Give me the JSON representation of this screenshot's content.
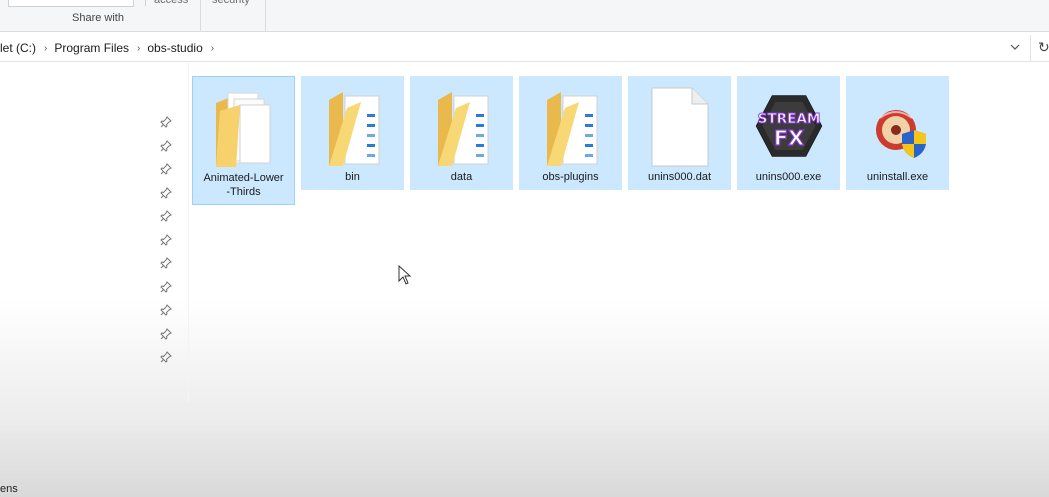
{
  "ribbon": {
    "groups": {
      "share": "Share with",
      "access": "access",
      "security": "security"
    }
  },
  "address": {
    "crumbs": [
      "let (C:)",
      "Program Files",
      "obs-studio"
    ]
  },
  "nav": {
    "pin_count": 11,
    "cut_label": "ens"
  },
  "files": [
    {
      "name": "Animated-Lower-Thirds",
      "name_line1": "Animated-Lower",
      "name_line2": "-Thirds",
      "type": "folder-docs",
      "icon": "folder-icon"
    },
    {
      "name": "bin",
      "type": "folder",
      "icon": "folder-icon"
    },
    {
      "name": "data",
      "type": "folder",
      "icon": "folder-icon"
    },
    {
      "name": "obs-plugins",
      "type": "folder",
      "icon": "folder-icon"
    },
    {
      "name": "unins000.dat",
      "type": "file",
      "icon": "blank-file-icon"
    },
    {
      "name": "unins000.exe",
      "type": "exe-streamfx",
      "icon": "streamfx-icon",
      "icon_text_top": "STREAM",
      "icon_text_bottom": "FX"
    },
    {
      "name": "uninstall.exe",
      "type": "exe-uninstall",
      "icon": "uninstall-icon"
    }
  ],
  "colors": {
    "selection": "#cce8ff",
    "selection_border": "#99d1ff",
    "folder": "#f8d775",
    "streamfx_purple": "#8a38d8"
  }
}
